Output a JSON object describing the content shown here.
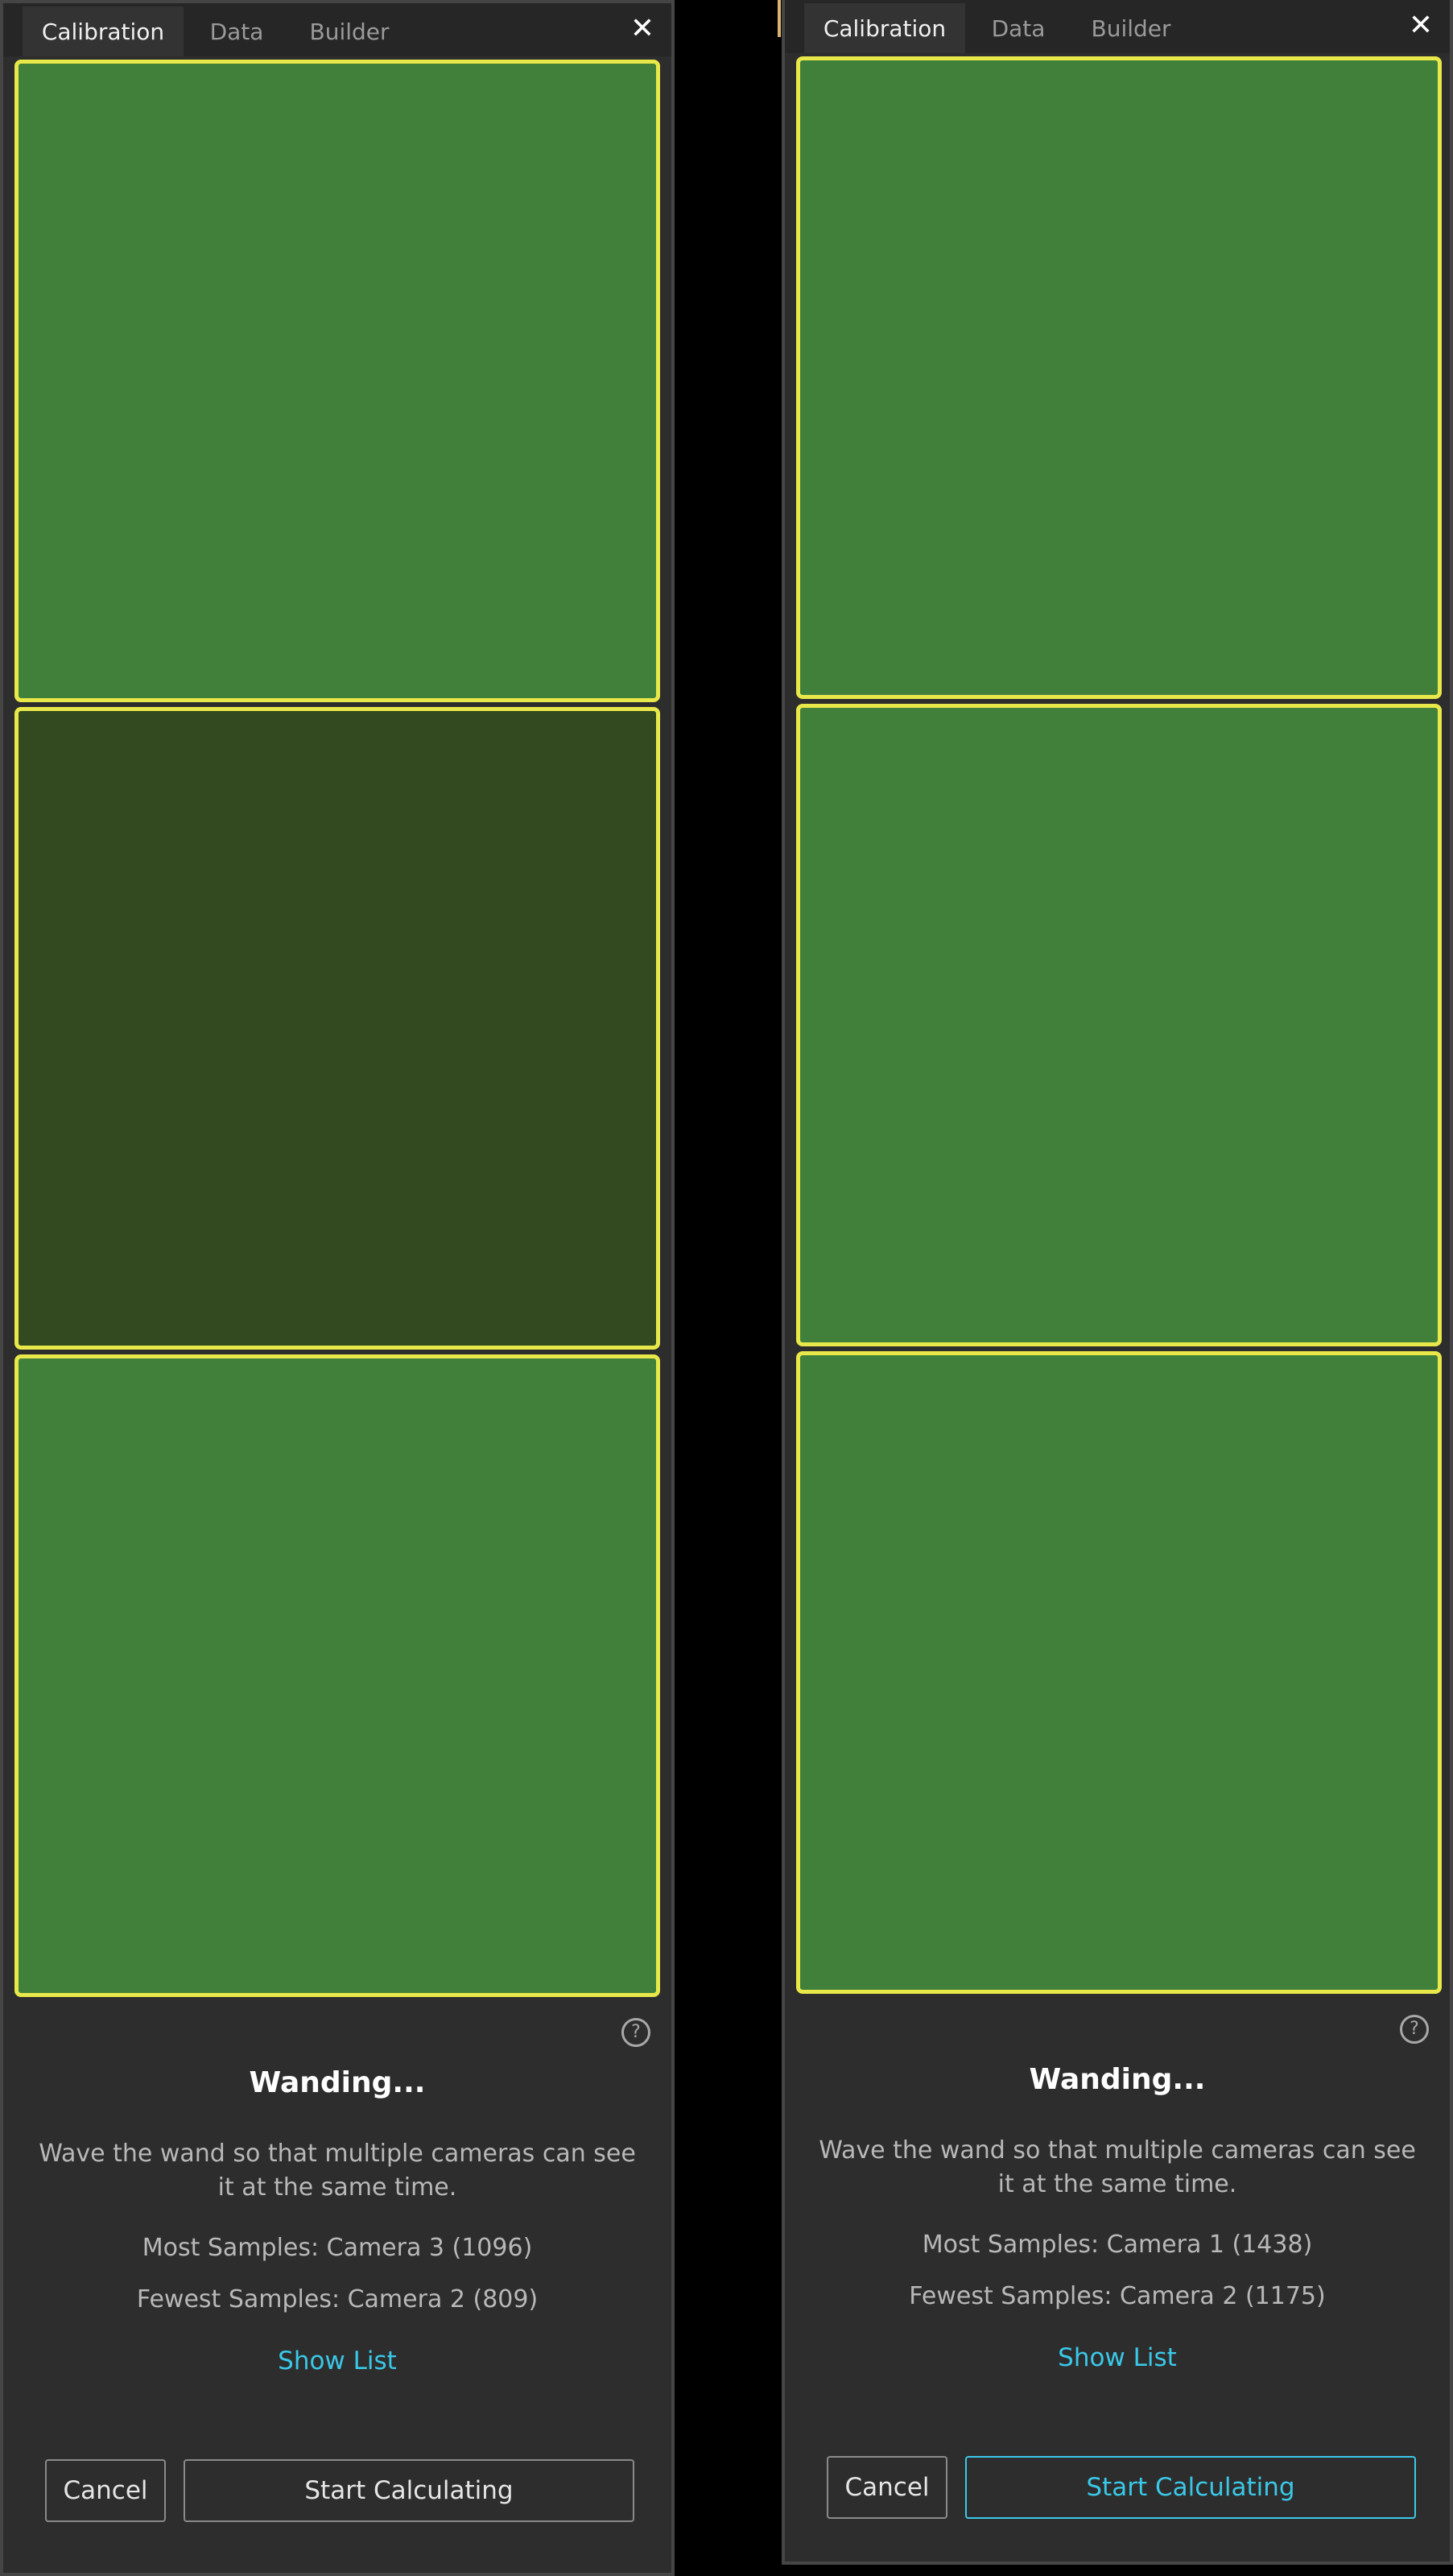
{
  "panels": [
    {
      "tabs": [
        {
          "label": "Calibration"
        },
        {
          "label": "Data"
        },
        {
          "label": "Builder"
        }
      ],
      "close_glyph": "✕",
      "camera_colors": [
        "#41803b",
        "#334920",
        "#41803b"
      ],
      "help_glyph": "?",
      "status": {
        "title": "Wanding...",
        "description": "Wave the wand so that multiple cameras can see it at the same time.",
        "most_samples": "Most Samples:  Camera 3 (1096)",
        "fewest_samples": "Fewest Samples:  Camera 2 (809)",
        "show_list": "Show List"
      },
      "buttons": {
        "cancel": "Cancel",
        "start": "Start Calculating"
      }
    },
    {
      "tabs": [
        {
          "label": "Calibration"
        },
        {
          "label": "Data"
        },
        {
          "label": "Builder"
        }
      ],
      "close_glyph": "✕",
      "camera_colors": [
        "#41803b",
        "#41803b",
        "#41803b"
      ],
      "help_glyph": "?",
      "status": {
        "title": "Wanding...",
        "description": "Wave the wand so that multiple cameras can see it at the same time.",
        "most_samples": "Most Samples:  Camera 1 (1438)",
        "fewest_samples": "Fewest Samples:  Camera 2 (1175)",
        "show_list": "Show List"
      },
      "buttons": {
        "cancel": "Cancel",
        "start": "Start Calculating"
      }
    }
  ],
  "colors": {
    "border_highlight": "#e8e84a",
    "link": "#3ac8e8",
    "panel_bg": "#2d2d2d"
  }
}
